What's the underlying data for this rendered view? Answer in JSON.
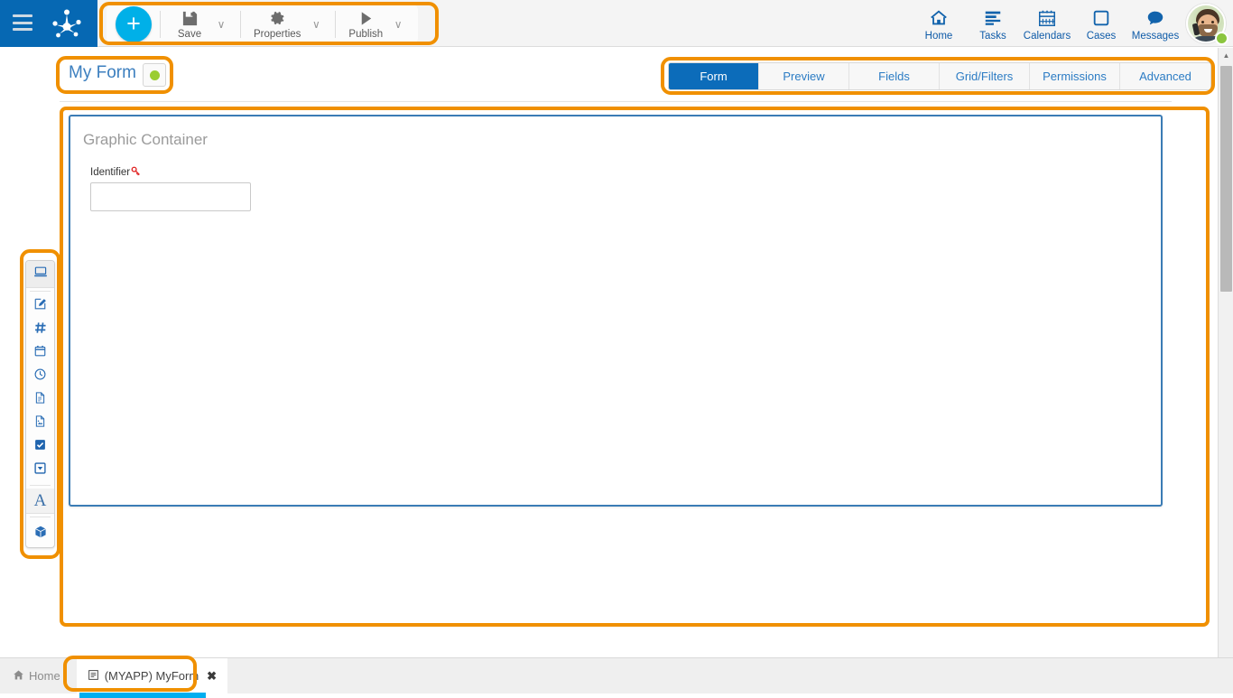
{
  "brand": {
    "logo_name": "bizagi-frog-logo",
    "menu_name": "hamburger-menu"
  },
  "toolbar": {
    "add_label": "+",
    "items": [
      {
        "label": "Save",
        "icon": "floppy-disk-icon",
        "caret": "∨"
      },
      {
        "label": "Properties",
        "icon": "gear-icon",
        "caret": "∨"
      },
      {
        "label": "Publish",
        "icon": "play-triangle-icon",
        "caret": "∨"
      }
    ]
  },
  "topnav": {
    "items": [
      {
        "label": "Home",
        "icon": "home-icon"
      },
      {
        "label": "Tasks",
        "icon": "tasks-list-icon"
      },
      {
        "label": "Calendars",
        "icon": "calendar-icon"
      },
      {
        "label": "Cases",
        "icon": "square-cases-icon"
      },
      {
        "label": "Messages",
        "icon": "chat-bubble-icon"
      }
    ],
    "avatar": {
      "name": "user-avatar",
      "presence_color": "#8bc53f"
    }
  },
  "header": {
    "form_title": "My Form",
    "status_dot_color": "#9acd32"
  },
  "tabs": [
    {
      "label": "Form",
      "active": true
    },
    {
      "label": "Preview",
      "active": false
    },
    {
      "label": "Fields",
      "active": false
    },
    {
      "label": "Grid/Filters",
      "active": false
    },
    {
      "label": "Permissions",
      "active": false
    },
    {
      "label": "Advanced",
      "active": false
    }
  ],
  "canvas": {
    "container_title": "Graphic Container",
    "field": {
      "label": "Identifier",
      "key_icon": "red-key-icon",
      "value": "",
      "placeholder": ""
    }
  },
  "palette": {
    "items": [
      {
        "name": "container-screen-icon",
        "selected": true
      },
      {
        "name": "text-edit-icon",
        "selected": false
      },
      {
        "name": "number-hash-icon",
        "selected": false
      },
      {
        "name": "date-calendar-icon",
        "selected": false
      },
      {
        "name": "time-clock-icon",
        "selected": false
      },
      {
        "name": "file-document-icon",
        "selected": false
      },
      {
        "name": "image-file-icon",
        "selected": false
      },
      {
        "name": "checkbox-checked-icon",
        "selected": false
      },
      {
        "name": "dropdown-select-icon",
        "selected": false
      },
      {
        "name": "text-letter-a-icon",
        "selected": false
      },
      {
        "name": "box-widget-icon",
        "selected": false
      }
    ]
  },
  "taskbar": {
    "home_label": "Home",
    "home_icon": "home-small-icon",
    "tab_label": "(MYAPP) MyForm",
    "tab_icon": "form-document-icon",
    "close_glyph": "✖"
  },
  "scroll": {
    "up_glyph": "▲",
    "down_glyph": "▼"
  },
  "annotations": {
    "color": "#f09000",
    "regions": [
      "toolbar-group",
      "form-title",
      "tab-strip",
      "canvas-area",
      "widget-palette",
      "taskbar-tab"
    ]
  }
}
